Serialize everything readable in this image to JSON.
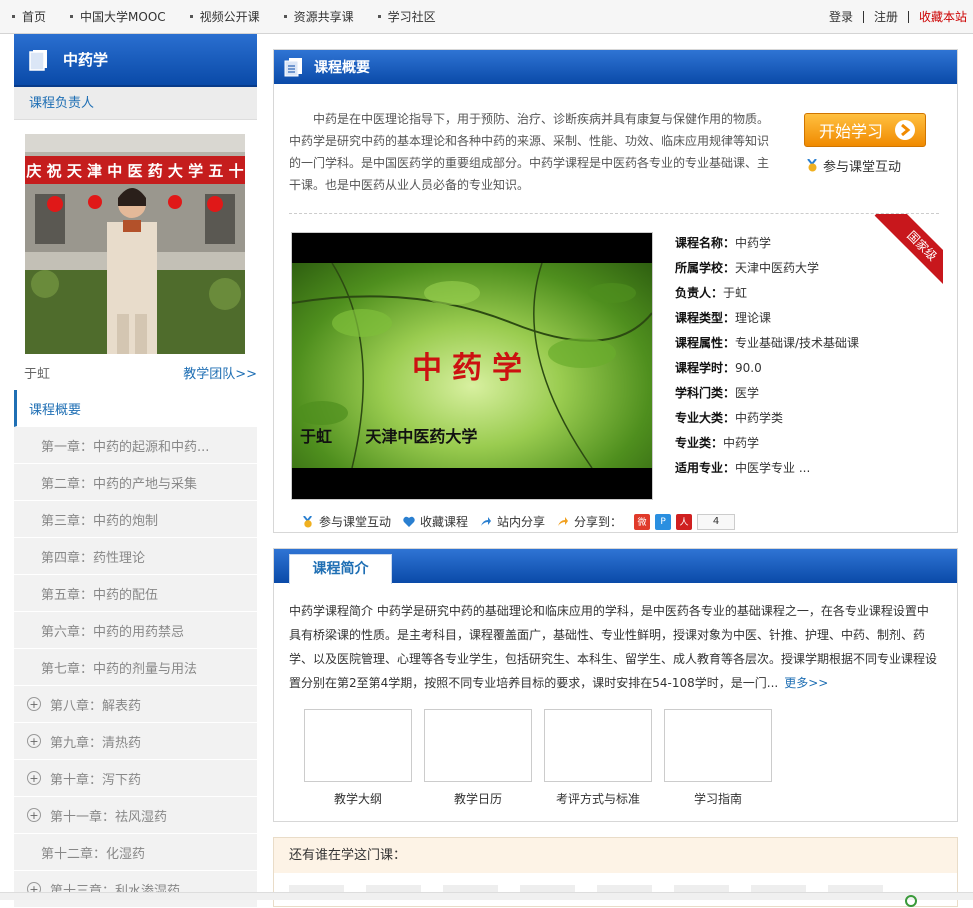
{
  "topbar": {
    "nav": [
      "首页",
      "中国大学MOOC",
      "视频公开课",
      "资源共享课",
      "学习社区"
    ],
    "login": "登录",
    "register": "注册",
    "favorite": "收藏本站"
  },
  "sidebar": {
    "course_title": "中药学",
    "leader_heading": "课程负责人",
    "teacher_name": "于虹",
    "team_link": "教学团队>>",
    "photo_banner": "庆 祝 天 津 中 医 药 大 学 五 十",
    "items": [
      {
        "label": "课程概要",
        "state": "active"
      },
      {
        "label": "第一章：中药的起源和中药...",
        "expandable": false
      },
      {
        "label": "第二章：中药的产地与采集",
        "expandable": false
      },
      {
        "label": "第三章：中药的炮制",
        "expandable": false
      },
      {
        "label": "第四章：药性理论",
        "expandable": false
      },
      {
        "label": "第五章：中药的配伍",
        "expandable": false
      },
      {
        "label": "第六章：中药的用药禁忌",
        "expandable": false
      },
      {
        "label": "第七章：中药的剂量与用法",
        "expandable": false
      },
      {
        "label": "第八章：解表药",
        "expandable": true
      },
      {
        "label": "第九章：清热药",
        "expandable": true
      },
      {
        "label": "第十章：泻下药",
        "expandable": true
      },
      {
        "label": "第十一章：祛风湿药",
        "expandable": true
      },
      {
        "label": "第十二章：化湿药",
        "expandable": false
      },
      {
        "label": "第十三章：利水渗湿药",
        "expandable": true
      }
    ]
  },
  "overview": {
    "title": "课程概要",
    "text": "中药是在中医理论指导下，用于预防、治疗、诊断疾病并具有康复与保健作用的物质。中药学是研究中药的基本理论和各种中药的来源、采制、性能、功效、临床应用规律等知识的一门学科。是中国医药学的重要组成部分。中药学课程是中医药各专业的专业基础课、主干课。也是中医药从业人员必备的专业知识。",
    "start_button": "开始学习",
    "interact_link": "参与课堂互动",
    "level_badge": "国家级",
    "video_title": "中药学",
    "video_subtitle": "于虹      天津中医药大学",
    "info": [
      {
        "k": "课程名称：",
        "v": "中药学"
      },
      {
        "k": "所属学校：",
        "v": "天津中医药大学"
      },
      {
        "k": "负责人：",
        "v": "于虹"
      },
      {
        "k": "课程类型：",
        "v": "理论课"
      },
      {
        "k": "课程属性：",
        "v": "专业基础课/技术基础课"
      },
      {
        "k": "课程学时：",
        "v": "90.0"
      },
      {
        "k": "学科门类：",
        "v": "医学"
      },
      {
        "k": "专业大类：",
        "v": "中药学类"
      },
      {
        "k": "专业类：",
        "v": "中药学"
      },
      {
        "k": "适用专业：",
        "v": "中医学专业 ..."
      }
    ],
    "actions": {
      "interact": "参与课堂互动",
      "collect": "收藏课程",
      "site_share": "站内分享",
      "share_to": "分享到：",
      "share_count": "4"
    }
  },
  "intro": {
    "tab": "课程简介",
    "text": "中药学课程简介 中药学是研究中药的基础理论和临床应用的学科，是中医药各专业的基础课程之一，在各专业课程设置中具有桥梁课的性质。是主考科目，课程覆盖面广，基础性、专业性鲜明，授课对象为中医、针推、护理、中药、制剂、药学、以及医院管理、心理等各专业学生，包括研究生、本科生、留学生、成人教育等各层次。授课学期根据不同专业课程设置分别在第2至第4学期，按照不同专业培养目标的要求，课时安排在54-108学时，是一门...",
    "more": "更多>>",
    "docs": [
      "教学大纲",
      "教学日历",
      "考评方式与标准",
      "学习指南"
    ]
  },
  "who_learning": {
    "title": "还有谁在学这门课："
  },
  "colors": {
    "brand_blue": "#0a4aa8",
    "link_blue": "#1f6fb4",
    "orange_button": "#f08a00",
    "badge_red": "#c8171c"
  }
}
